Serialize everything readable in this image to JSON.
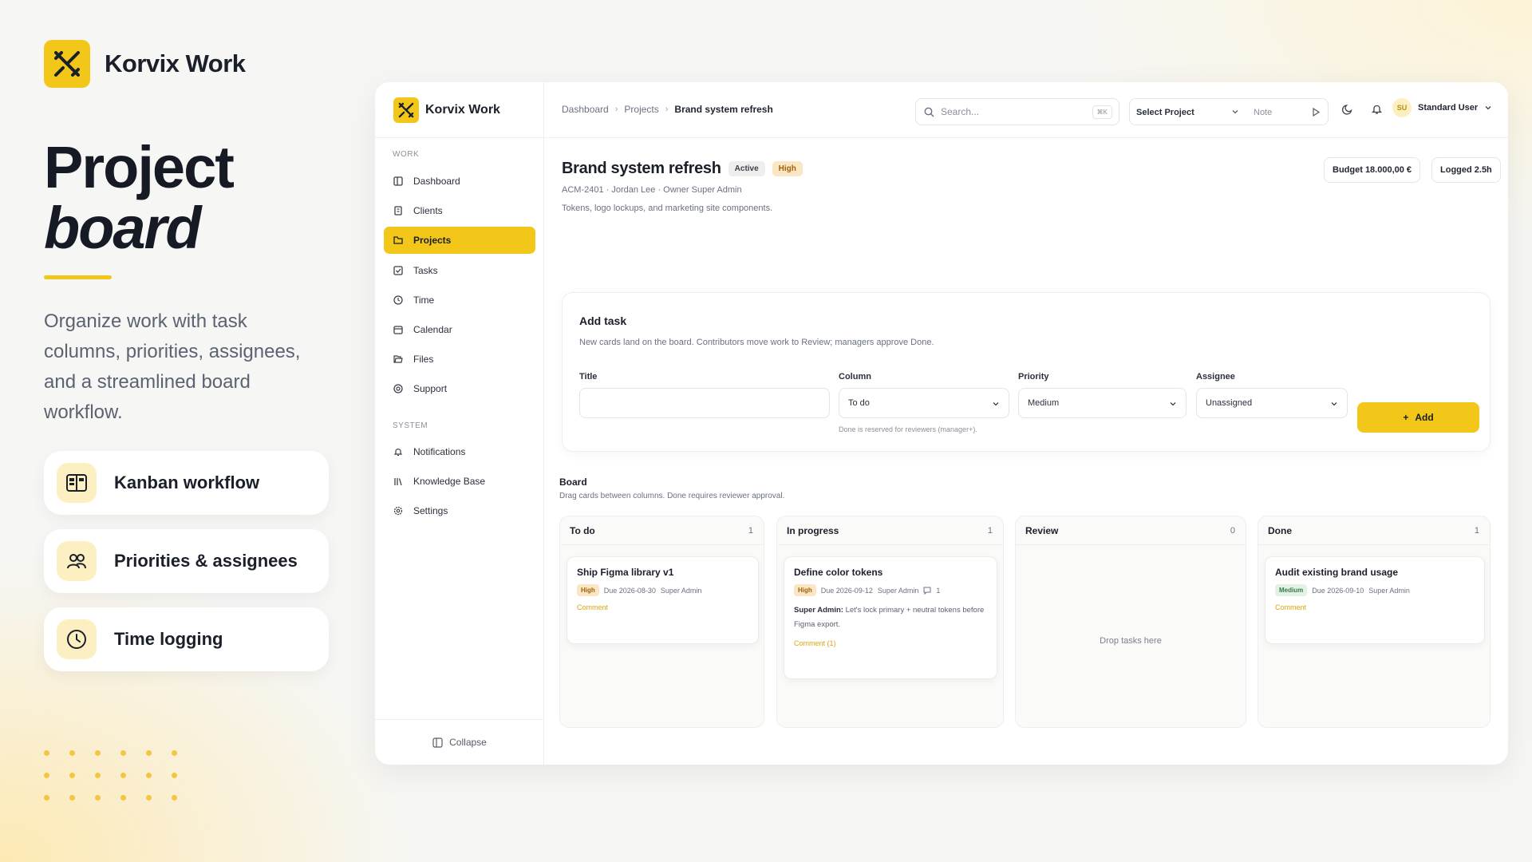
{
  "marketing": {
    "brand_name": "Korvix Work",
    "title_line1": "Project",
    "title_line2": "board",
    "description": "Organize work with task columns, priorities, assignees, and a streamlined board workflow.",
    "features": [
      {
        "label": "Kanban workflow",
        "icon": "kanban-icon"
      },
      {
        "label": "Priorities & assignees",
        "icon": "users-icon"
      },
      {
        "label": "Time logging",
        "icon": "clock-icon"
      }
    ],
    "accent_color": "#f2c71a"
  },
  "sidebar": {
    "brand_name": "Korvix Work",
    "section_work": "WORK",
    "section_system": "SYSTEM",
    "items": [
      {
        "label": "Dashboard",
        "icon": "dashboard-icon"
      },
      {
        "label": "Clients",
        "icon": "building-icon"
      },
      {
        "label": "Projects",
        "icon": "folder-icon",
        "active": true
      },
      {
        "label": "Tasks",
        "icon": "checkbox-icon"
      },
      {
        "label": "Time",
        "icon": "clock-icon"
      },
      {
        "label": "Calendar",
        "icon": "calendar-icon"
      },
      {
        "label": "Files",
        "icon": "folder-open-icon"
      },
      {
        "label": "Support",
        "icon": "lifebuoy-icon"
      }
    ],
    "system_items": [
      {
        "label": "Notifications",
        "icon": "bell-icon"
      },
      {
        "label": "Knowledge Base",
        "icon": "library-icon"
      },
      {
        "label": "Settings",
        "icon": "gear-icon"
      }
    ],
    "collapse_label": "Collapse"
  },
  "topbar": {
    "breadcrumbs": [
      "Dashboard",
      "Projects",
      "Brand system refresh"
    ],
    "search_placeholder": "Search...",
    "search_shortcut": "⌘K",
    "select_project": "Select Project",
    "note_placeholder": "Note",
    "user_initials": "SU",
    "user_name": "Standard User"
  },
  "project": {
    "title": "Brand system refresh",
    "status_badge": "Active",
    "priority_badge": "High",
    "meta": "ACM-2401 · Jordan Lee · Owner Super Admin",
    "description": "Tokens, logo lockups, and marketing site components.",
    "budget": "Budget 18.000,00 €",
    "logged": "Logged 2.5h"
  },
  "add_task": {
    "heading": "Add task",
    "subtitle": "New cards land on the board. Contributors move work to Review; managers approve Done.",
    "title_label": "Title",
    "title_value": "",
    "column_label": "Column",
    "column_value": "To do",
    "column_hint": "Done is reserved for reviewers (manager+).",
    "priority_label": "Priority",
    "priority_value": "Medium",
    "assignee_label": "Assignee",
    "assignee_value": "Unassigned",
    "add_button": "Add"
  },
  "board": {
    "heading": "Board",
    "subtitle": "Drag cards between columns. Done requires reviewer approval.",
    "columns": [
      {
        "name": "To do",
        "count": "1"
      },
      {
        "name": "In progress",
        "count": "1"
      },
      {
        "name": "Review",
        "count": "0",
        "empty_text": "Drop tasks here"
      },
      {
        "name": "Done",
        "count": "1"
      }
    ],
    "cards": {
      "todo": {
        "title": "Ship Figma library v1",
        "priority": "High",
        "due": "Due 2026-08-30",
        "assignee": "Super Admin",
        "action": "Comment"
      },
      "inprogress": {
        "title": "Define color tokens",
        "priority": "High",
        "due": "Due 2026-09-12",
        "assignee": "Super Admin",
        "comment_count": "1",
        "comment_author": "Super Admin:",
        "comment_text": "Let's lock primary + neutral tokens before Figma export.",
        "action": "Comment (1)"
      },
      "done": {
        "title": "Audit existing brand usage",
        "priority": "Medium",
        "due": "Due 2026-09-10",
        "assignee": "Super Admin",
        "action": "Comment"
      }
    }
  }
}
